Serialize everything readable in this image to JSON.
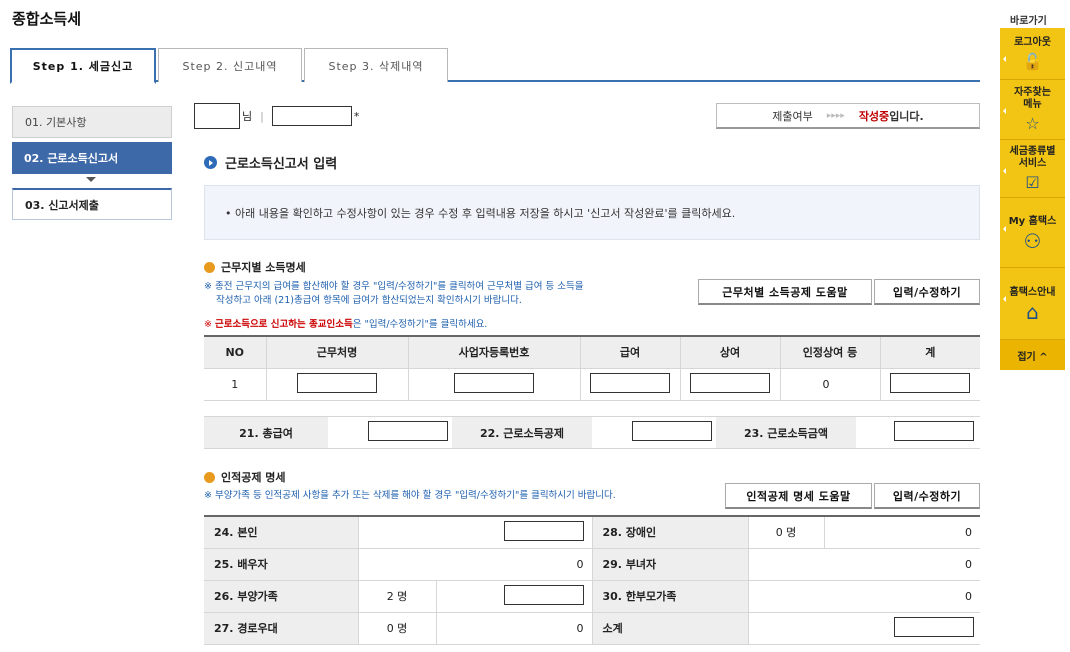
{
  "page": {
    "title": "종합소득세"
  },
  "tabs": [
    {
      "label": "Step 1. 세금신고",
      "active": true
    },
    {
      "label": "Step 2. 신고내역",
      "active": false
    },
    {
      "label": "Step 3. 삭제내역",
      "active": false
    }
  ],
  "left_nav": [
    {
      "label": "01. 기본사항"
    },
    {
      "label": "02. 근로소득신고서"
    },
    {
      "label": "03. 신고서제출"
    }
  ],
  "user": {
    "suffix": "님",
    "separator": "|",
    "asterisk": "*"
  },
  "submit_status": {
    "label": "제출여부",
    "arrows": "▸▸▸▸",
    "state": "작성중",
    "suffix": "입니다."
  },
  "section": {
    "title": "근로소득신고서 입력"
  },
  "notice": {
    "text": "• 아래 내용을 확인하고 수정사항이 있는 경우 수정 후 입력내용 저장을 하시고 '신고서 작성완료'를 클릭하세요."
  },
  "income": {
    "title": "근무지별 소득명세",
    "note_line1": "※ 종전 근무지의 급여를 합산해야 할 경우 \"입력/수정하기\"를 클릭하여 근무처별 급여 등 소득을",
    "note_line2": "작성하고 아래 (21)총급여 항목에 급여가 합산되었는지 확인하시기 바랍니다.",
    "red_note_prefix": "※ ",
    "red_note_bold": "근로소득으로 신고하는 종교인소득",
    "red_note_rest": "은 \"입력/수정하기\"를 클릭하세요.",
    "help_button": "근무처별 소득공제 도움말",
    "edit_button": "입력/수정하기",
    "columns": [
      "NO",
      "근무처명",
      "사업자등록번호",
      "급여",
      "상여",
      "인정상여 등",
      "계"
    ],
    "rows": [
      {
        "no": "1",
        "recognized_bonus": "0"
      }
    ]
  },
  "summary": {
    "total_salary_label": "21. 총급여",
    "earned_income_deduction_label": "22. 근로소득공제",
    "earned_income_amount_label": "23. 근로소득금액"
  },
  "personal": {
    "title": "인적공제 명세",
    "note": "※ 부양가족 등 인적공제 사항을 추가 또는 삭제를 해야 할 경우 \"입력/수정하기\"를 클릭하시기 바랍니다.",
    "help_button": "인적공제 명세 도움말",
    "edit_button": "입력/수정하기",
    "self_label": "24. 본인",
    "disabled_label": "28. 장애인",
    "disabled_count": "0 명",
    "disabled_amount": "0",
    "spouse_label": "25. 배우자",
    "spouse_amount": "0",
    "female_label": "29. 부녀자",
    "female_amount": "0",
    "dependents_label": "26. 부양가족",
    "dependents_count": "2 명",
    "single_parent_label": "30. 한부모가족",
    "single_parent_amount": "0",
    "elderly_label": "27. 경로우대",
    "elderly_count": "0 명",
    "elderly_amount": "0",
    "subtotal_label": "소계"
  },
  "quick": {
    "label": "바로가기",
    "items": [
      {
        "label": "로그아웃",
        "icon": "lock-icon",
        "glyph": "🔓"
      },
      {
        "label": "자주찾는\n메뉴",
        "icon": "star-icon",
        "glyph": "☆"
      },
      {
        "label": "세금종류별\n서비스",
        "icon": "checkbox-icon",
        "glyph": "☑"
      },
      {
        "label": "My 홈택스",
        "icon": "user-icon",
        "glyph": "⚇"
      },
      {
        "label": "홈택스안내",
        "icon": "home-icon",
        "glyph": "⌂"
      }
    ],
    "close": "접기 ^"
  },
  "colors": {
    "accent": "#3e69a8",
    "status_red": "#c00000",
    "quick_bg": "#f2c413"
  }
}
